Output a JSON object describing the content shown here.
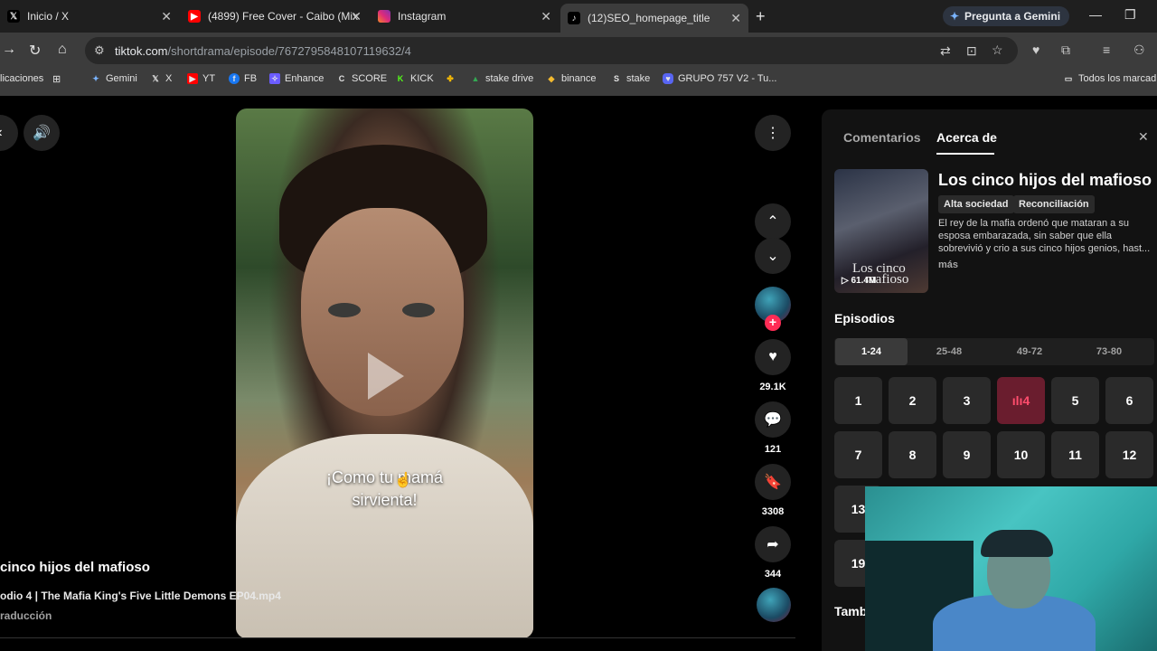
{
  "tabs": [
    {
      "title": "Inicio / X",
      "icon": "x-logo-icon",
      "active": false
    },
    {
      "title": "(4899) Free Cover - Caibo (Mix",
      "icon": "youtube-icon",
      "active": false
    },
    {
      "title": "Instagram",
      "icon": "instagram-icon",
      "active": false
    },
    {
      "title": "(12)SEO_homepage_title",
      "icon": "tiktok-icon",
      "active": true
    }
  ],
  "gemini_button": "Pregunta a Gemini",
  "address": {
    "domain": "tiktok.com",
    "path": "/shortdrama/episode/7672795848107119632/4"
  },
  "bookmarks": [
    "licaciones",
    "Gemini",
    "X",
    "YT",
    "FB",
    "Enhance",
    "SCORE",
    "KICK",
    "",
    "stake drive",
    "binance",
    "stake",
    "GRUPO 757 V2 - Tu...",
    "Todos los marcad"
  ],
  "video": {
    "caption_line1": "¡Como tu mamá",
    "caption_line2": "sirvienta!"
  },
  "actions": {
    "likes": "29.1K",
    "comments": "121",
    "saves": "3308",
    "shares": "344"
  },
  "info": {
    "title": "cinco hijos del mafioso",
    "subtitle": "odio 4 | The Mafia King's Five Little Demons EP04.mp4",
    "translation": "raducción"
  },
  "panel": {
    "tab_comments": "Comentarios",
    "tab_about": "Acerca de",
    "show_title": "Los cinco hijos del mafioso",
    "tags": [
      "Alta sociedad",
      "Reconciliación"
    ],
    "description": "El rey de la mafia ordenó que mataran a su esposa embarazada, sin saber que ella sobrevivió y crio a sus cinco hijos genios, hast...",
    "more": "más",
    "poster_text_1": "Los cinco",
    "poster_text_2": "mafioso",
    "views": "61.4M",
    "episodes_heading": "Episodios",
    "ranges": [
      "1-24",
      "25-48",
      "49-72",
      "73-80"
    ],
    "episodes_row1": [
      "1",
      "2",
      "3",
      "4",
      "5",
      "6"
    ],
    "episodes_row2": [
      "7",
      "8",
      "9",
      "10",
      "11",
      "12"
    ],
    "episodes_row3": [
      "13"
    ],
    "episodes_row4": [
      "19"
    ],
    "also_heading": "Tamb"
  },
  "colors": {
    "accent": "#fe2c55",
    "panel_bg": "#121212",
    "active_episode_bg": "#6a1d2e"
  }
}
